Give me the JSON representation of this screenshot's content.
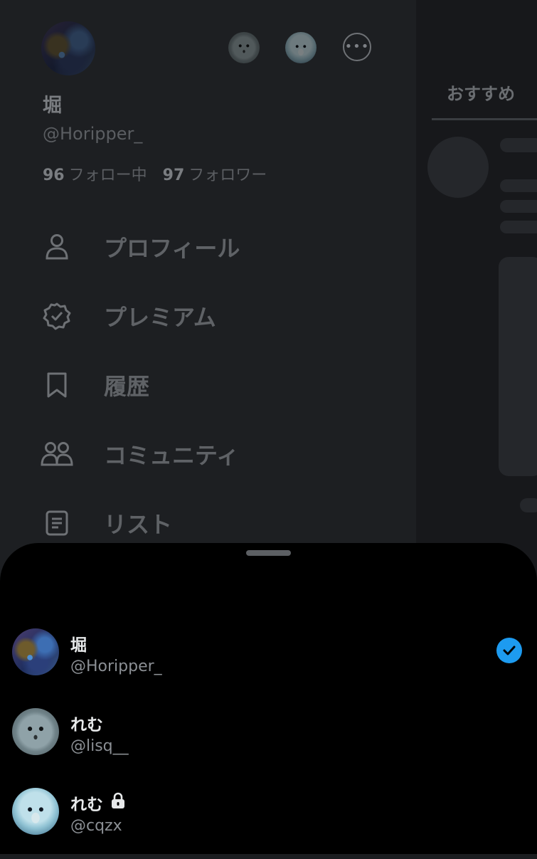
{
  "drawer": {
    "profile": {
      "name": "堀",
      "handle": "@Horipper_",
      "following_count": "96",
      "following_label": "フォロー中",
      "followers_count": "97",
      "followers_label": "フォロワー"
    },
    "menu": [
      {
        "label": "プロフィール",
        "icon": "person-icon"
      },
      {
        "label": "プレミアム",
        "icon": "verified-badge-icon"
      },
      {
        "label": "履歴",
        "icon": "bookmark-icon"
      },
      {
        "label": "コミュニティ",
        "icon": "people-icon"
      },
      {
        "label": "リスト",
        "icon": "list-icon"
      }
    ]
  },
  "timeline": {
    "tab_label": "おすすめ"
  },
  "account_switcher": {
    "accounts": [
      {
        "name": "堀",
        "handle": "@Horipper_",
        "selected": true,
        "locked": false
      },
      {
        "name": "れむ",
        "handle": "@lisq__",
        "selected": false,
        "locked": false
      },
      {
        "name": "れむ",
        "handle": "@cqzx",
        "selected": false,
        "locked": true
      }
    ]
  },
  "colors": {
    "accent": "#1d9bf0",
    "sheet_background": "#000000",
    "drawer_background": "#1d1f22"
  }
}
